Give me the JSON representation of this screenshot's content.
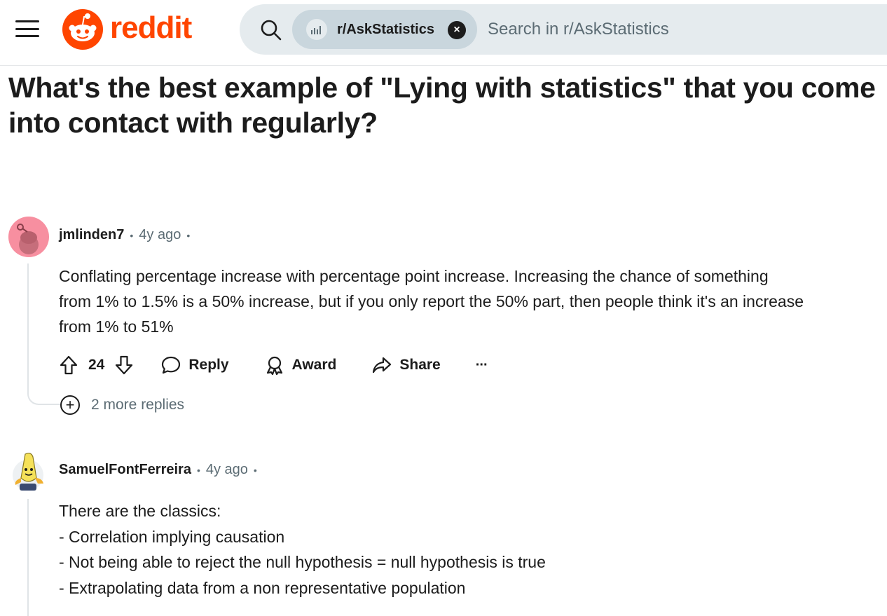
{
  "header": {
    "brand": "reddit",
    "subreddit_chip": "r/AskStatistics",
    "search_placeholder": "Search in r/AskStatistics",
    "brand_color": "#ff4500"
  },
  "post": {
    "title": "What's the best example of \"Lying with statistics\" that you come into contact with regularly?"
  },
  "comments": [
    {
      "author": "jmlinden7",
      "time": "4y ago",
      "body": [
        "Conflating percentage increase with percentage point increase. Increasing the chance of something",
        "from 1% to 1.5% is a 50% increase, but if you only report the 50% part, then people think it's an increase",
        "from 1% to 51%"
      ],
      "votes": "24",
      "actions": {
        "reply": "Reply",
        "award": "Award",
        "share": "Share",
        "more": "···"
      },
      "more_replies": "2 more replies",
      "avatar_color": "#f78fa0"
    },
    {
      "author": "SamuelFontFerreira",
      "time": "4y ago",
      "body": [
        "There are the classics:",
        "- Correlation implying causation",
        "- Not being able to reject the null hypothesis = null hypothesis is true",
        "- Extrapolating data from a non representative population"
      ]
    }
  ]
}
